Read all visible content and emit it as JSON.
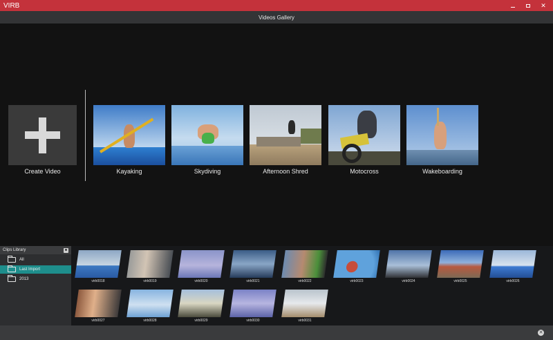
{
  "window": {
    "app_name": "VIRB",
    "title": "Videos Gallery",
    "accent_color": "#c4323b"
  },
  "gallery": {
    "create_label": "Create Video",
    "videos": [
      {
        "title": "Kayaking"
      },
      {
        "title": "Skydiving"
      },
      {
        "title": "Afternoon Shred"
      },
      {
        "title": "Motocross"
      },
      {
        "title": "Wakeboarding"
      }
    ]
  },
  "clips_library": {
    "title": "Clips Library",
    "folders": [
      {
        "label": "All",
        "selected": false
      },
      {
        "label": "Last Import",
        "selected": true
      },
      {
        "label": "2013",
        "selected": false
      }
    ],
    "selected_color": "#1e8e8c",
    "clips": [
      "virb0018",
      "virb0019",
      "virb0020",
      "virb0021",
      "virb0022",
      "virb0023",
      "virb0024",
      "virb0025",
      "virb0026",
      "virb0027",
      "virb0028",
      "virb0029",
      "virb0030",
      "virb0031"
    ]
  }
}
